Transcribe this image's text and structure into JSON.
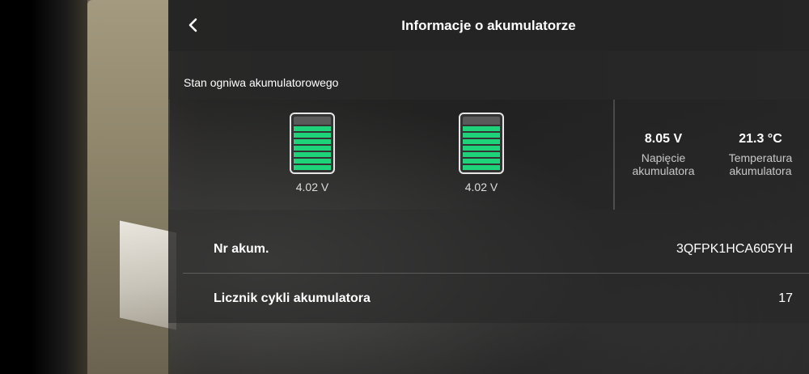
{
  "header": {
    "title": "Informacje o akumulatorze",
    "back_icon": "chevron-left-icon"
  },
  "section": {
    "label": "Stan ogniwa akumulatorowego"
  },
  "cells": [
    {
      "voltage": "4.02 V",
      "charge_fraction": 1.0
    },
    {
      "voltage": "4.02 V",
      "charge_fraction": 1.0
    }
  ],
  "stats": {
    "voltage": {
      "value": "8.05 V",
      "label": "Napięcie akumulatora"
    },
    "temperature": {
      "value": "21.3 °C",
      "label": "Temperatura akumulatora"
    }
  },
  "info": {
    "serial": {
      "key": "Nr akum.",
      "value": "3QFPK1HCA605YH"
    },
    "cycles": {
      "key": "Licznik cykli akumulatora",
      "value": "17"
    }
  },
  "colors": {
    "battery_fill": "#1fd37a",
    "panel_header": "#242424"
  }
}
